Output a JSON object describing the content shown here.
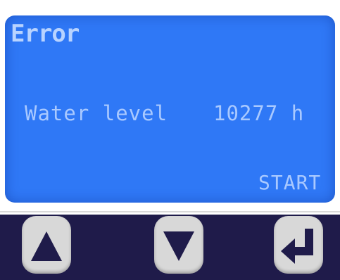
{
  "display": {
    "title": "Error",
    "message_label": "Water level",
    "message_value": "10277 h",
    "softkey_label": "START",
    "background_color": "#2f78f6",
    "text_color": "#a9c9ff"
  },
  "keypad": {
    "background_color": "#1f1b4a",
    "keys": [
      {
        "icon": "arrow-up-icon"
      },
      {
        "icon": "arrow-down-icon"
      },
      {
        "icon": "enter-return-icon"
      }
    ]
  }
}
